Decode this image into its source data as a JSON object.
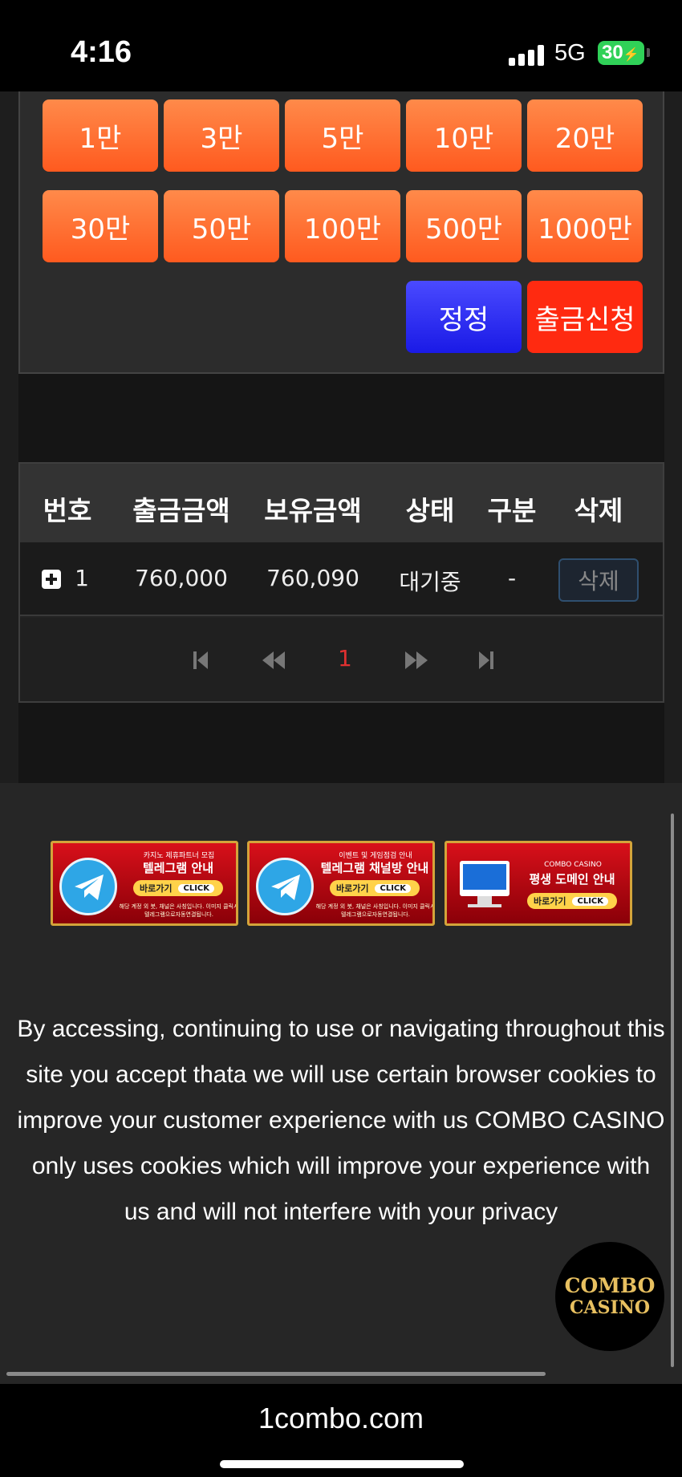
{
  "status": {
    "time": "4:16",
    "network": "5G",
    "battery": "30"
  },
  "amounts": {
    "row1": [
      "1만",
      "3만",
      "5만",
      "10만",
      "20만"
    ],
    "row2": [
      "30만",
      "50만",
      "100만",
      "500만",
      "1000만"
    ]
  },
  "actions": {
    "reset_label": "정정",
    "withdraw_label": "출금신청"
  },
  "table": {
    "headers": [
      "번호",
      "출금금액",
      "보유금액",
      "상태",
      "구분",
      "삭제"
    ],
    "rows": [
      {
        "no": "1",
        "withdraw_amount": "760,000",
        "held_amount": "760,090",
        "status": "대기중",
        "category": "-",
        "delete_label": "삭제"
      }
    ]
  },
  "pagination": {
    "current_page": "1"
  },
  "banners": [
    {
      "top": "카지노 제휴파트너 모집",
      "title": "텔레그램 안내",
      "button": "바로가기",
      "click": "CLICK",
      "note": "해당 계정 외 봇, 채널은 사칭입니다. 이미지 클릭시 텔레그램으로자동연결됩니다.",
      "icon": "telegram-icon"
    },
    {
      "top": "이벤트 및 게임점검 안내",
      "title": "텔레그램 채널방 안내",
      "button": "바로가기",
      "click": "CLICK",
      "note": "해당 계정 외 봇, 채널은 사칭입니다. 이미지 클릭시 텔레그램으로자동연결됩니다.",
      "icon": "telegram-icon"
    },
    {
      "top": "COMBO CASINO",
      "title": "평생 도메인 안내",
      "button": "바로가기",
      "click": "CLICK",
      "icon": "monitor-icon"
    }
  ],
  "cookie_notice": "By accessing, continuing to use or navigating throughout this site you accept thata we will use certain browser cookies to improve your customer experience with us COMBO CASINO only uses cookies which will improve your experience with us and will not interfere with your privacy",
  "logo": {
    "line1": "COMBO",
    "line2": "CASINO"
  },
  "browser": {
    "url": "1combo.com"
  },
  "colors": {
    "amount_button": "#ff6a2a",
    "reset_button": "#2323ee",
    "withdraw_button": "#ff2a10",
    "page_active": "#e03030",
    "logo_gold": "#e8c060"
  }
}
